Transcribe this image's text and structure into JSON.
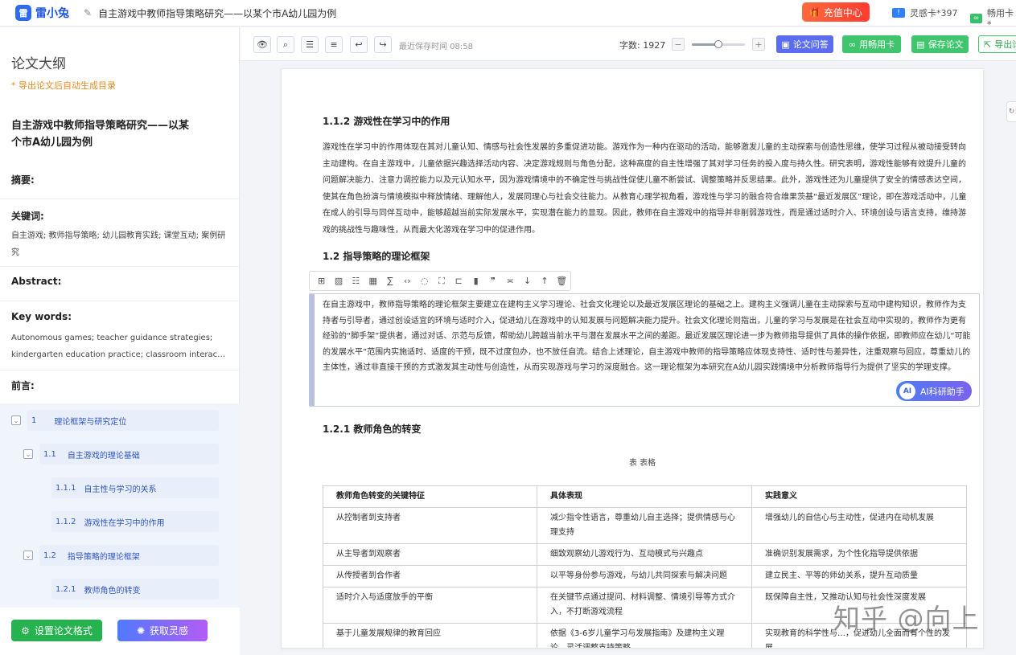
{
  "header": {
    "logo_mark": "雷",
    "logo_text": "雷小兔",
    "doc_title": "自主游戏中教师指导策略研究——以某个市A幼儿园为例",
    "recharge_label": "充值中心",
    "card1_label": "灵感卡*397",
    "card2_label": "畅用卡*"
  },
  "sidebar": {
    "title": "论文大纲",
    "hint": "* 导出论文后自动生成目录",
    "paper_title": "自主游戏中教师指导策略研究——以某个市A幼儿园为例",
    "abstract_label": "摘要:",
    "keywords_label": "关键词:",
    "keywords_text": "自主游戏; 教师指导策略; 幼儿园教育实践; 课堂互动; 案例研究",
    "abstract_en_label": "Abstract:",
    "keywords_en_label": "Key words:",
    "keywords_en_line1": "Autonomous games; teacher guidance strategies;",
    "keywords_en_line2": "kindergarten education practice; classroom interaction; case study",
    "preface_label": "前言:",
    "toc": [
      {
        "num": "1",
        "label": "理论框架与研究定位"
      },
      {
        "num": "1.1",
        "label": "自主游戏的理论基础"
      },
      {
        "num": "1.1.1",
        "label": "自主性与学习的关系"
      },
      {
        "num": "1.1.2",
        "label": "游戏性在学习中的作用"
      },
      {
        "num": "1.2",
        "label": "指导策略的理论框架"
      },
      {
        "num": "1.2.1",
        "label": "教师角色的转变"
      }
    ],
    "btn_format": "设置论文格式",
    "btn_inspiration": "获取灵感"
  },
  "toolbar": {
    "save_time": "最近保存时间 08:58",
    "word_count": "字数: 1927",
    "zoom": 0.5,
    "btn_qa": "论文问答",
    "btn_card": "用畅用卡",
    "btn_save": "保存论文",
    "btn_export": "导出论"
  },
  "doc": {
    "h_112": "1.1.2 游戏性在学习中的作用",
    "p1": "游戏性在学习中的作用体现在其对儿童认知、情感与社会性发展的多重促进功能。游戏作为一种内在驱动的活动，能够激发儿童的主动探索与创造性思维，使学习过程从被动接受转向主动建构。在自主游戏中，儿童依据兴趣选择活动内容、决定游戏规则与角色分配，这种高度的自主性增强了其对学习任务的投入度与持久性。研究表明，游戏性能够有效提升儿童的问题解决能力、注意力调控能力以及元认知水平，因为游戏情境中的不确定性与挑战性促使儿童不断尝试、调整策略并反思结果。此外，游戏性还为儿童提供了安全的情感表达空间，使其在角色扮演与情境模拟中释放情绪、理解他人，发展同理心与社会交往能力。从教育心理学视角看，游戏性与学习的融合符合维果茨基“最近发展区”理论，即在游戏活动中，儿童在成人的引导与同伴互动中，能够超越当前实际发展水平，实现潜在能力的显现。因此，教师在自主游戏中的指导并非削弱游戏性，而是通过适时介入、环境创设与语言支持，维持游戏的挑战性与趣味性，从而最大化游戏在学习中的促进作用。",
    "h_12": "1.2 指导策略的理论框架",
    "p2": "在自主游戏中，教师指导策略的理论框架主要建立在建构主义学习理论、社会文化理论以及最近发展区理论的基础之上。建构主义强调儿童在主动探索与互动中建构知识，教师作为支持者与引导者，通过创设适宜的环境与适时介入，促进幼儿在游戏中的认知发展与问题解决能力提升。社会文化理论则指出，儿童的学习与发展是在社会互动中实现的，教师作为更有经验的“脚手架”提供者，通过对话、示范与反馈，帮助幼儿跨越当前水平与潜在发展水平之间的差距。最近发展区理论进一步为教师指导提供了具体的操作依据，即教师应在幼儿“可能的发展水平”范围内实施适时、适度的干预，既不过度包办，也不放任自流。结合上述理论，自主游戏中教师的指导策略应体现支持性、适时性与差异性，注重观察与回应，尊重幼儿的主体性，通过非直接干预的方式激发其主动性与创造性，从而实现游戏与学习的深度融合。这一理论框架为本研究在A幼儿园实践情境中分析教师指导行为提供了坚实的学理支撑。",
    "ai_label": "AI科研助手",
    "ai_bot": "AI",
    "h_121": "1.2.1 教师角色的转变",
    "table_caption": "表  表格",
    "table_headers": [
      "教师角色转变的关键特征",
      "具体表现",
      "实践意义"
    ],
    "table_rows": [
      [
        "从控制者到支持者",
        "减少指令性语言，尊重幼儿自主选择；提供情感与心理支持",
        "增强幼儿的自信心与主动性，促进内在动机发展"
      ],
      [
        "从主导者到观察者",
        "细致观察幼儿游戏行为、互动模式与兴趣点",
        "准确识别发展需求，为个性化指导提供依据"
      ],
      [
        "从传授者到合作者",
        "以平等身份参与游戏，与幼儿共同探索与解决问题",
        "建立民主、平等的师幼关系，提升互动质量"
      ],
      [
        "适时介入与适度放手的平衡",
        "在关键节点通过提问、材料调整、情境引导等方式介入，不打断游戏流程",
        "既保障自主性，又推动认知与社会性深度发展"
      ],
      [
        "基于儿童发展规律的教育回应",
        "依据《3-6岁儿童学习与发展指南》及建构主义理论，灵活调整支持策略",
        "实现教育的科学性与…，促进幼儿全面而有个性的发展"
      ]
    ]
  },
  "watermark": "知乎 @向上",
  "colors": {
    "brand": "#2f6bf0",
    "recharge": "#ff4a33",
    "green": "#3fc56b",
    "qa": "#5a6df0"
  }
}
